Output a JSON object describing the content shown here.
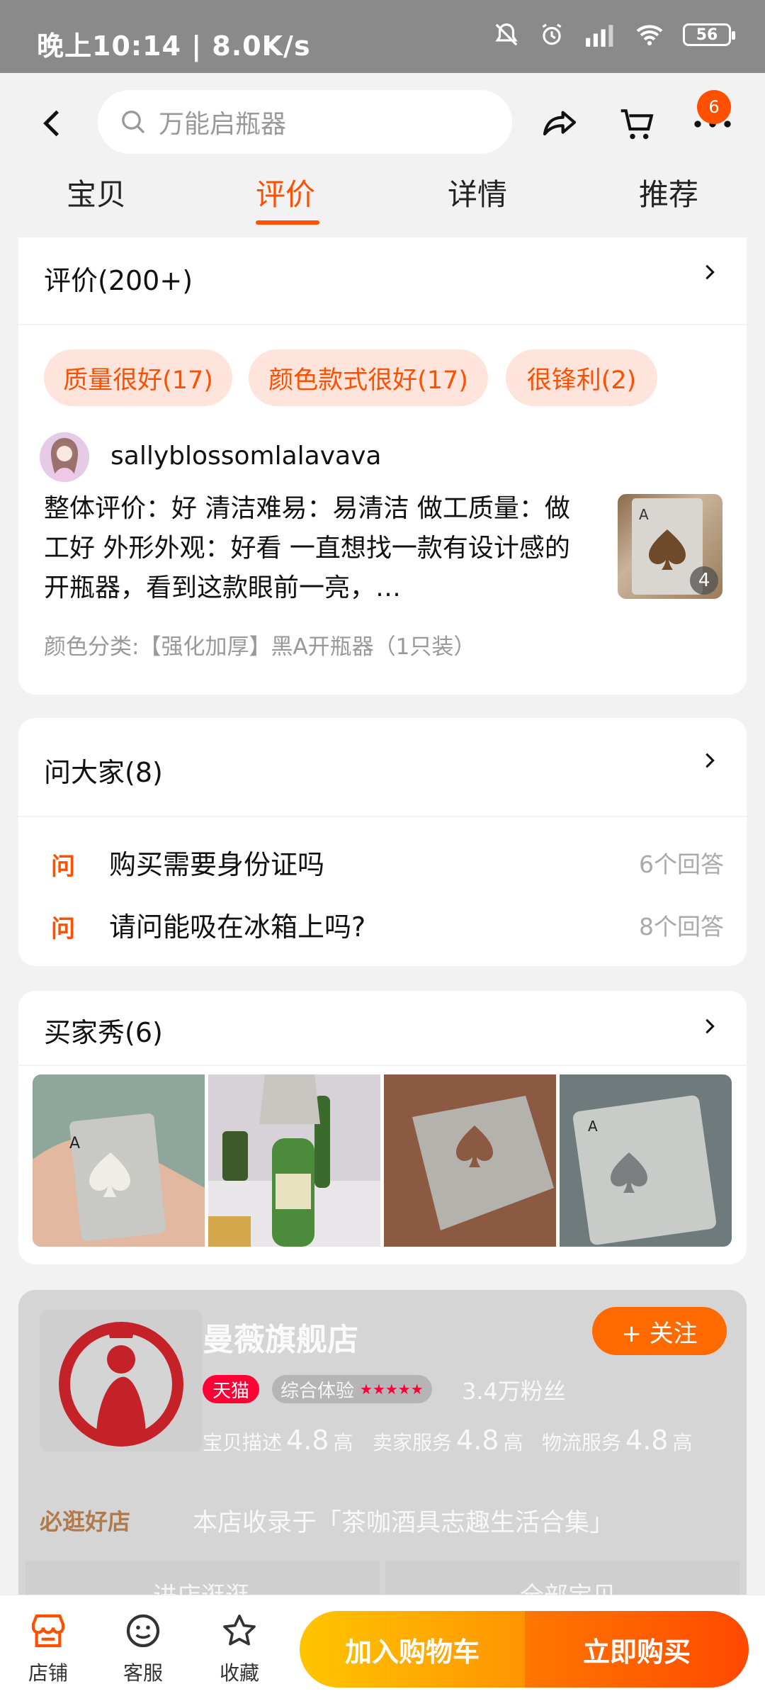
{
  "status_bar": {
    "time": "晚上10:14 | 8.0K/s",
    "battery": "56"
  },
  "header": {
    "search_placeholder": "万能启瓶器",
    "cart_badge": "6",
    "tabs": [
      "宝贝",
      "评价",
      "详情",
      "推荐"
    ],
    "active_tab": "评价"
  },
  "reviews": {
    "title": "评价(200+)",
    "tags": [
      "质量很好(17)",
      "颜色款式很好(17)",
      "很锋利(2)"
    ],
    "username": "sallyblossomlalavava",
    "text": "整体评价：好 清洁难易：易清洁 做工质量：做工好 外形外观：好看 一直想找一款有设计感的开瓶器，看到这款眼前一亮，…",
    "image_count": "4",
    "category": "颜色分类:【强化加厚】黑A开瓶器（1只装）"
  },
  "qa": {
    "title": "问大家(8)",
    "q_marker": "问",
    "items": [
      {
        "question": "购买需要身份证吗",
        "answers": "6个回答"
      },
      {
        "question": "请问能吸在冰箱上吗?",
        "answers": "8个回答"
      }
    ]
  },
  "buyer_show": {
    "title": "买家秀(6)"
  },
  "shop": {
    "name": "曼薇旗舰店",
    "follow": "+ 关注",
    "tmall": "天猫",
    "experience": "综合体验",
    "experience_stars": "★★★★★",
    "fans": "3.4万粉丝",
    "metrics": [
      {
        "label": "宝贝描述",
        "value": "4.8",
        "level": "高"
      },
      {
        "label": "卖家服务",
        "value": "4.8",
        "level": "高"
      },
      {
        "label": "物流服务",
        "value": "4.8",
        "level": "高"
      }
    ],
    "badge": "必逛好店",
    "collection": "本店收录于「茶咖酒具志趣生活合集」",
    "buttons": [
      "进店逛逛",
      "全部宝贝"
    ]
  },
  "bottom_bar": {
    "store": "店铺",
    "service": "客服",
    "favorite": "收藏",
    "add_cart": "加入购物车",
    "buy_now": "立即购买"
  },
  "colors": {
    "accent": "#ff5000",
    "tmall": "#ff0036"
  }
}
